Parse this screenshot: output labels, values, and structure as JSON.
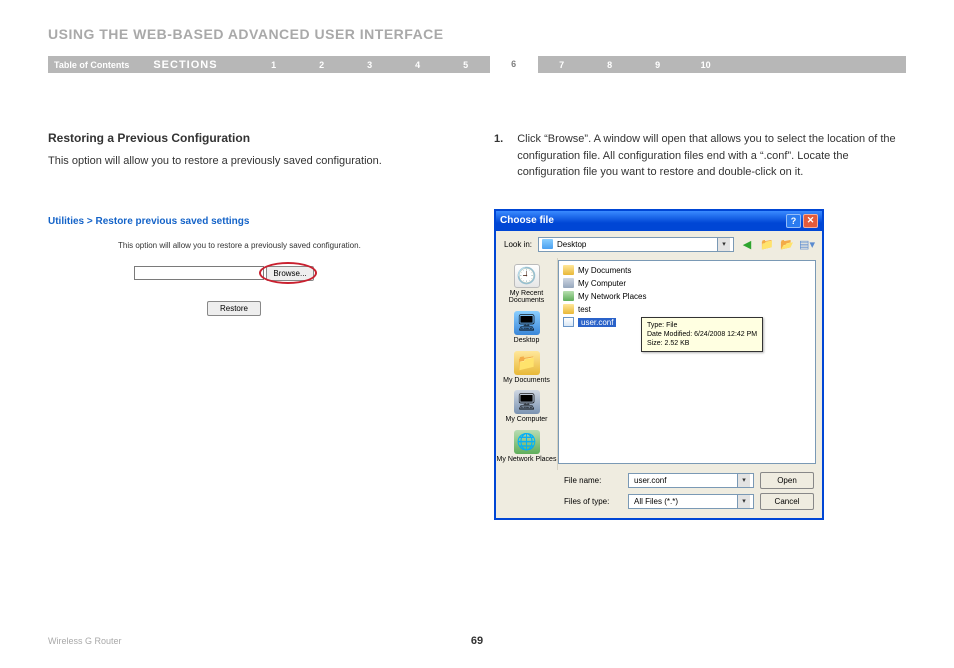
{
  "title": "USING THE WEB-BASED ADVANCED USER INTERFACE",
  "nav": {
    "toc": "Table of Contents",
    "sections_label": "SECTIONS",
    "items": [
      "1",
      "2",
      "3",
      "4",
      "5",
      "6",
      "7",
      "8",
      "9",
      "10"
    ],
    "active_index": 5
  },
  "left": {
    "subheading": "Restoring a Previous Configuration",
    "body": "This option will allow you to restore a previously saved configuration.",
    "crumb": "Utilities > Restore previous saved settings",
    "desc": "This option will allow you to restore a previously saved configuration.",
    "browse_label": "Browse...",
    "restore_label": "Restore"
  },
  "right": {
    "step_num": "1.",
    "step_text": "Click “Browse”. A window will open that allows you to select the location of the configuration file. All configuration files end with a “.conf”. Locate the configuration file you want to restore and double-click on it."
  },
  "dialog": {
    "title": "Choose file",
    "lookin_label": "Look in:",
    "lookin_value": "Desktop",
    "sidebar": {
      "recent": "My Recent Documents",
      "desktop": "Desktop",
      "mydocs": "My Documents",
      "mycomp": "My Computer",
      "mynet": "My Network Places"
    },
    "files": {
      "f0": "My Documents",
      "f1": "My Computer",
      "f2": "My Network Places",
      "f3": "test",
      "f4": "user.conf"
    },
    "tooltip": {
      "l0": "Type: File",
      "l1": "Date Modified: 6/24/2008 12:42 PM",
      "l2": "Size: 2.52 KB"
    },
    "filename_label": "File name:",
    "filename_value": "user.conf",
    "filetype_label": "Files of type:",
    "filetype_value": "All Files (*.*)",
    "open_label": "Open",
    "cancel_label": "Cancel"
  },
  "footer": {
    "product": "Wireless G Router",
    "page": "69"
  }
}
